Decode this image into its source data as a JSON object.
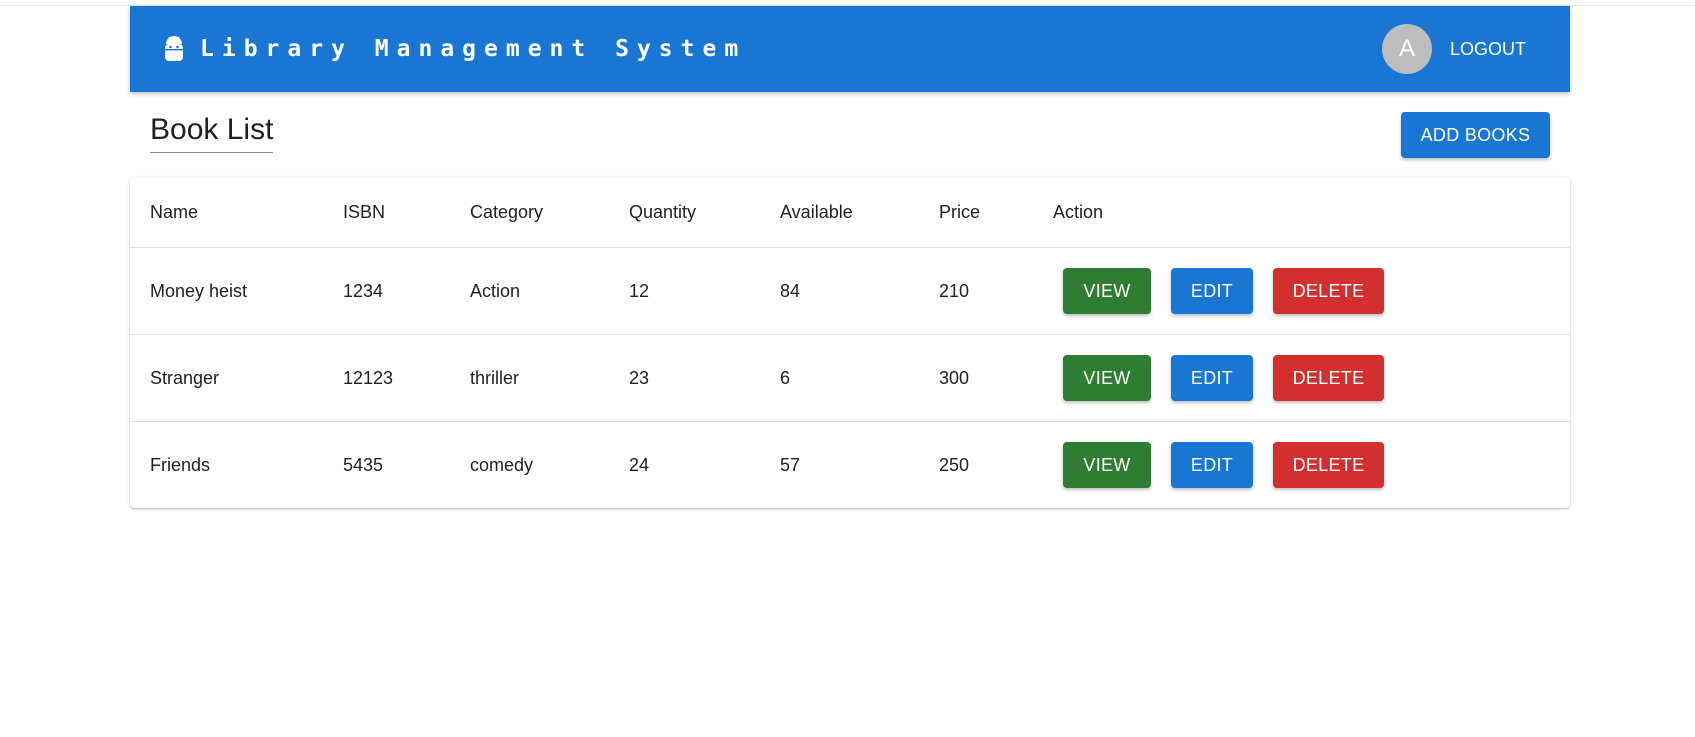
{
  "app": {
    "title": "Library Management System",
    "logo_icon": "android-icon",
    "avatar_letter": "A",
    "logout_label": "LOGOUT",
    "primary_color": "#1976d2"
  },
  "page": {
    "title": "Book List",
    "add_button_label": "ADD BOOKS"
  },
  "table": {
    "headers": [
      "Name",
      "ISBN",
      "Category",
      "Quantity",
      "Available",
      "Price",
      "Action"
    ],
    "rows": [
      {
        "name": "Money heist",
        "isbn": "1234",
        "category": "Action",
        "quantity": "12",
        "available": "84",
        "price": "210"
      },
      {
        "name": "Stranger",
        "isbn": "12123",
        "category": "thriller",
        "quantity": "23",
        "available": "6",
        "price": "300"
      },
      {
        "name": "Friends",
        "isbn": "5435",
        "category": "comedy",
        "quantity": "24",
        "available": "57",
        "price": "250"
      }
    ],
    "actions": {
      "view_label": "VIEW",
      "edit_label": "EDIT",
      "delete_label": "DELETE",
      "view_color": "#2e7d32",
      "edit_color": "#1976d2",
      "delete_color": "#d32f2f"
    }
  }
}
